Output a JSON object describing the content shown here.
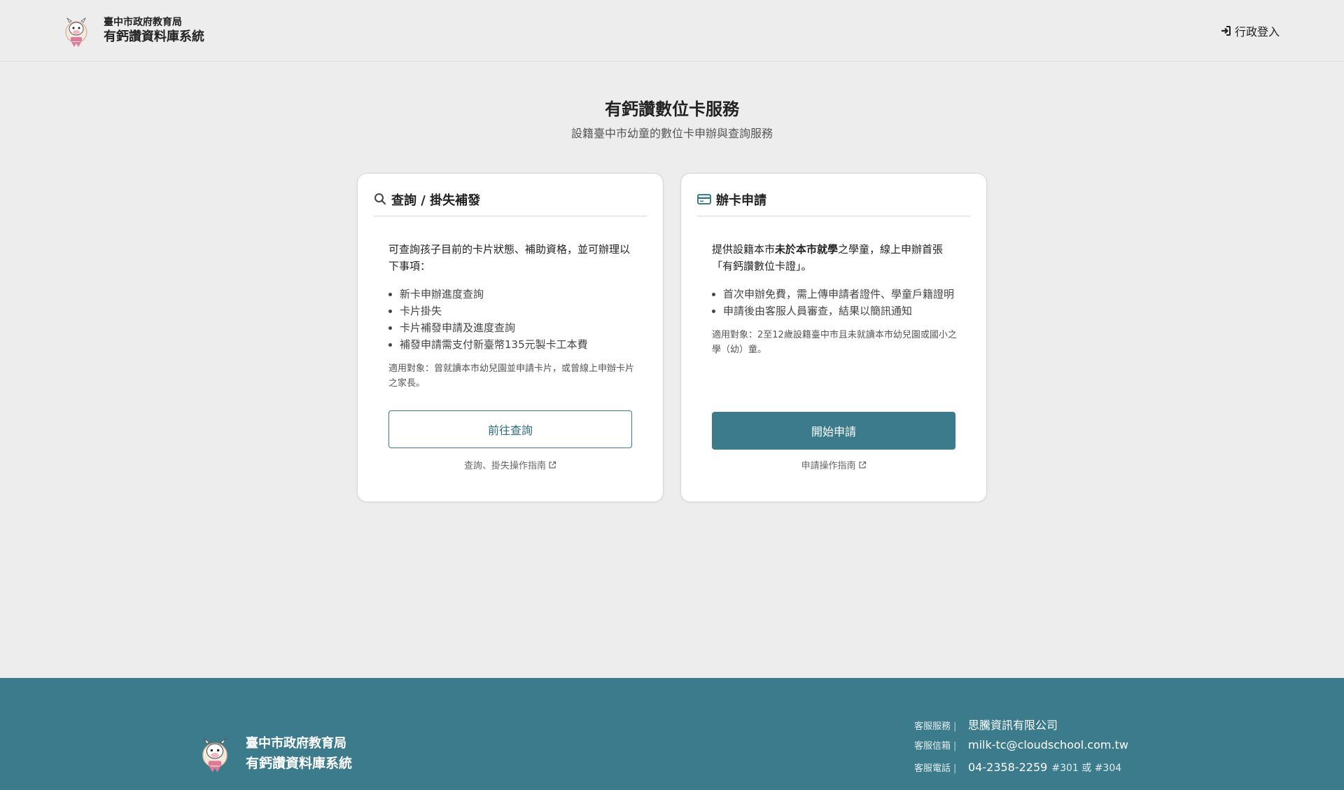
{
  "header": {
    "org": "臺中市政府教育局",
    "system": "有鈣讚資料庫系統",
    "admin_login": "行政登入"
  },
  "intro": {
    "title": "有鈣讚數位卡服務",
    "subtitle": "設籍臺中市幼童的數位卡申辦與查詢服務"
  },
  "query_card": {
    "title": "查詢 / 掛失補發",
    "description": "可查詢孩子目前的卡片狀態、補助資格，並可辦理以下事項：",
    "items": [
      "新卡申辦進度查詢",
      "卡片掛失",
      "卡片補發申請及進度查詢",
      "補發申請需支付新臺幣135元製卡工本費"
    ],
    "note": "適用對象：曾就讀本市幼兒園並申請卡片，或曾線上申辦卡片之家長。",
    "button": "前往查詢",
    "guide_link": "查詢、掛失操作指南"
  },
  "apply_card": {
    "title": "辦卡申請",
    "description_pre": "提供設籍本市",
    "description_bold": "未於本市就學",
    "description_post": "之學童，線上申辦首張「有鈣讚數位卡證」。",
    "items": [
      "首次申辦免費，需上傳申請者證件、學童戶籍證明",
      "申請後由客服人員審查，結果以簡訊通知"
    ],
    "note": "適用對象：2至12歲設籍臺中市且未就讀本市幼兒園或國小之學（幼）童。",
    "button": "開始申請",
    "guide_link": "申請操作指南"
  },
  "footer": {
    "org": "臺中市政府教育局",
    "system": "有鈣讚資料庫系統",
    "contacts": [
      {
        "label": "客服服務",
        "value": "思騰資訊有限公司",
        "ext": ""
      },
      {
        "label": "客服信箱",
        "value": "milk-tc@cloudschool.com.tw",
        "ext": ""
      },
      {
        "label": "客服電話",
        "value": "04-2358-2259",
        "ext": "#301 或 #304"
      }
    ]
  },
  "colors": {
    "accent": "#3b7b8b",
    "background": "#ededed",
    "card": "#ffffff"
  }
}
